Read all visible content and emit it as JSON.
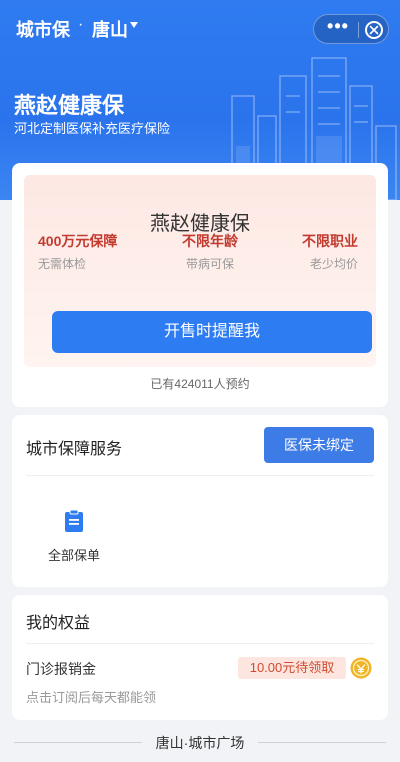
{
  "header": {
    "app_title": "城市保",
    "separator": "·",
    "city": "唐山",
    "menu_more": "•••"
  },
  "hero": {
    "title": "燕赵健康保",
    "subtitle": "河北定制医保补充医疗保险"
  },
  "product": {
    "name": "燕赵健康保",
    "features": [
      {
        "title": "400万元保障",
        "desc": "无需体检"
      },
      {
        "title": "不限年龄",
        "desc": "带病可保"
      },
      {
        "title": "不限职业",
        "desc": "老少均价"
      }
    ],
    "remind_button": "开售时提醒我",
    "reserved_text": "已有424011人预约"
  },
  "service": {
    "title": "城市保障服务",
    "bind_button": "医保未绑定",
    "items": [
      {
        "label": "全部保单",
        "icon": "clipboard-icon"
      }
    ]
  },
  "rights": {
    "title": "我的权益",
    "item_label": "门诊报销金",
    "claim_text": "10.00元待领取",
    "description": "点击订阅后每天都能领"
  },
  "footer": {
    "text": "唐山·城市广场"
  },
  "colors": {
    "primary": "#2e7cf2",
    "accent_red": "#c33a2f",
    "coin_gold": "#f0b429"
  }
}
